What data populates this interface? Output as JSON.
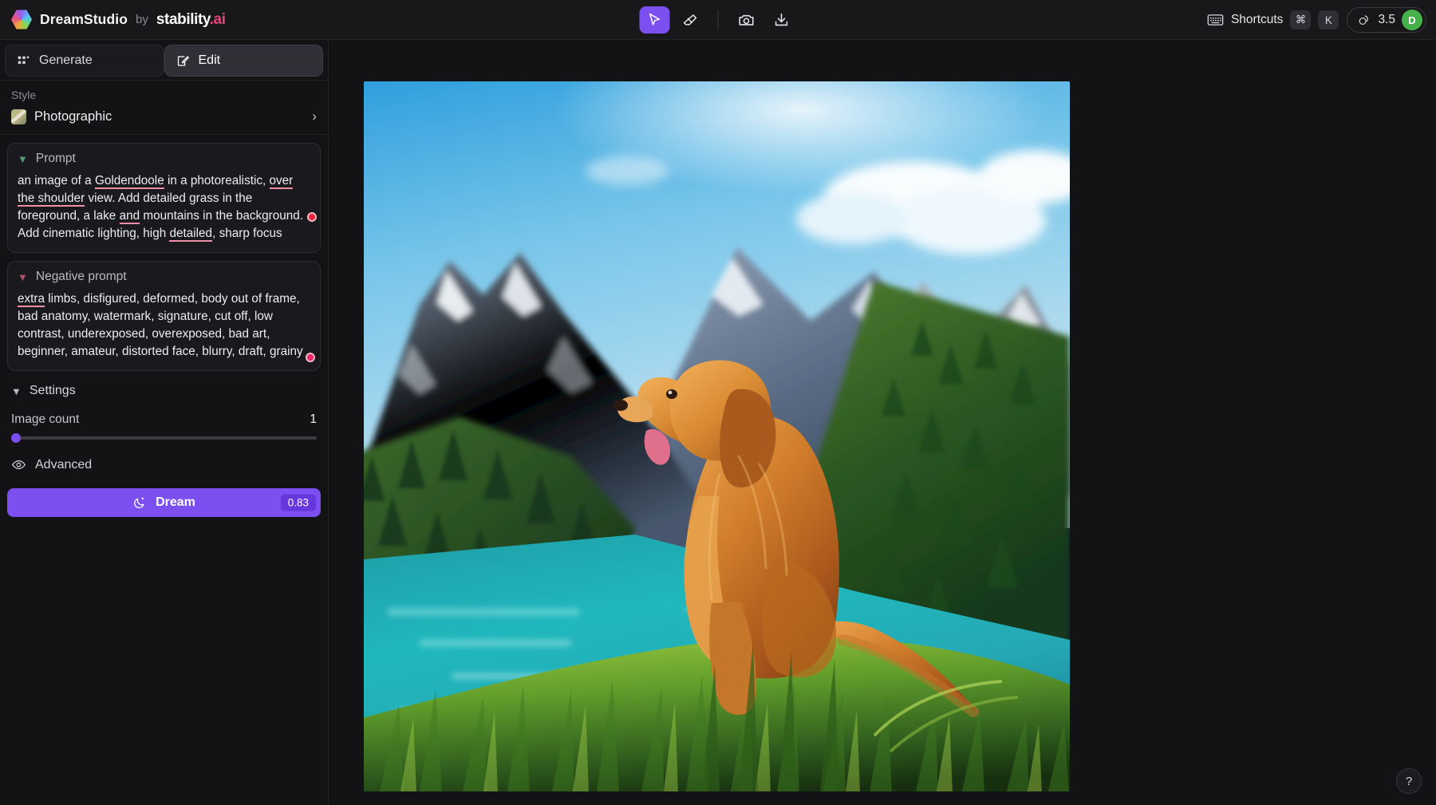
{
  "app": {
    "brand_name": "DreamStudio",
    "brand_by": "by",
    "brand_company": "stability",
    "brand_company_tld": ".ai"
  },
  "toolbar": {
    "tools": [
      {
        "name": "select-tool",
        "icon": "cursor-arrow-icon",
        "active": true
      },
      {
        "name": "eraser-tool",
        "icon": "eraser-icon",
        "active": false
      },
      {
        "name": "screenshot-tool",
        "icon": "camera-icon",
        "active": false
      },
      {
        "name": "download-tool",
        "icon": "download-icon",
        "active": false
      }
    ]
  },
  "topright": {
    "shortcuts_label": "Shortcuts",
    "key_modifier": "⌘",
    "key_letter": "K",
    "credits": "3.5",
    "avatar_initial": "D",
    "avatar_color": "#46b04a"
  },
  "sidebar": {
    "tabs": [
      {
        "label": "Generate",
        "icon": "grid-dots-icon",
        "active": false
      },
      {
        "label": "Edit",
        "icon": "pencil-square-icon",
        "active": true
      }
    ],
    "style": {
      "section_label": "Style",
      "selected": "Photographic"
    },
    "prompt": {
      "title": "Prompt",
      "text": "an image of a Goldendoole in a photorealistic, over the shoulder view. Add detailed grass in the foreground, a lake and mountains in the background. Add cinematic lighting, high detailed, sharp focus",
      "spellcheck_words": [
        "Goldendoole",
        "over the shoulder",
        "and",
        "detailed"
      ]
    },
    "negative_prompt": {
      "title": "Negative prompt",
      "text": "extra limbs, disfigured, deformed, body out of frame, bad anatomy, watermark, signature, cut off, low contrast, underexposed, overexposed, bad art, beginner, amateur, distorted face, blurry, draft, grainy",
      "spellcheck_words": [
        "extra"
      ]
    },
    "settings": {
      "title": "Settings",
      "image_count_label": "Image count",
      "image_count_value": "1",
      "image_count_percent": 0,
      "advanced_label": "Advanced"
    },
    "dream": {
      "label": "Dream",
      "cost": "0.83",
      "accent_color": "#7c4ff0"
    }
  },
  "canvas": {
    "help_label": "?",
    "artwork_alt": "Golden retriever dog sitting on grass by a turquoise lake with mountains"
  }
}
